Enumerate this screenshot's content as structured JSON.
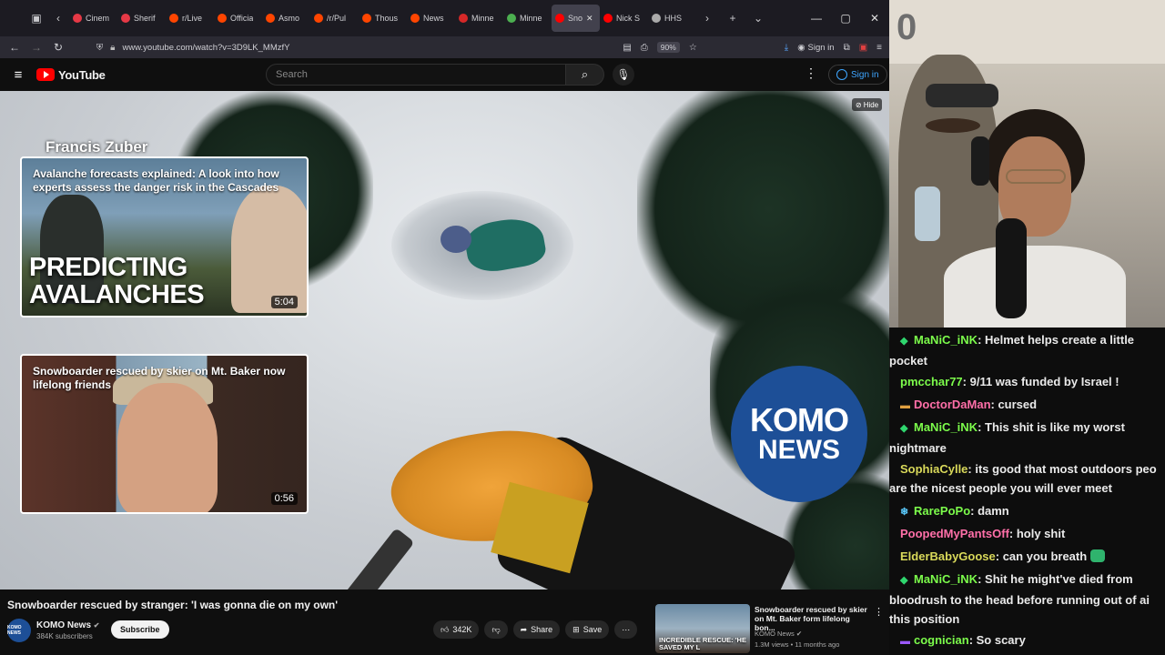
{
  "browser": {
    "tabs": [
      {
        "label": "Cinem",
        "active": false,
        "color": "#e63946"
      },
      {
        "label": "Sherif",
        "active": false,
        "color": "#e63946"
      },
      {
        "label": "r/Live",
        "active": false,
        "color": "#ff4500"
      },
      {
        "label": "Officia",
        "active": false,
        "color": "#ff4500"
      },
      {
        "label": "Asmo",
        "active": false,
        "color": "#ff4500"
      },
      {
        "label": "/r/Pul",
        "active": false,
        "color": "#ff4500"
      },
      {
        "label": "Thous",
        "active": false,
        "color": "#ff4500"
      },
      {
        "label": "News",
        "active": false,
        "color": "#ff4500"
      },
      {
        "label": "Minne",
        "active": false,
        "color": "#d62828"
      },
      {
        "label": "Minne",
        "active": false,
        "color": "#4caf50"
      },
      {
        "label": "Sno",
        "active": true,
        "color": "#ff0000"
      },
      {
        "label": "Nick S",
        "active": false,
        "color": "#ff0000"
      },
      {
        "label": "HHS",
        "active": false,
        "color": "#aaaaaa"
      }
    ],
    "url": "www.youtube.com/watch?v=3D9LK_MMzfY",
    "zoom": "90%",
    "signin_label": "Sign in"
  },
  "youtube": {
    "logo_text": "YouTube",
    "search_placeholder": "Search",
    "signin_label": "Sign in",
    "hide_label": "Hide"
  },
  "video": {
    "author_overlay": "Francis Zuber",
    "endcards": [
      {
        "title": "Avalanche forecasts explained: A look into how experts assess the danger risk in the Cascades",
        "big_text": "PREDICTING AVALANCHES",
        "duration": "5:04"
      },
      {
        "title": "Snowboarder rescued by skier on Mt. Baker now lifelong friends",
        "duration": "0:56"
      }
    ],
    "komo_line1": "KOMO",
    "komo_line2": "NEWS",
    "title": "Snowboarder rescued by stranger: 'I was gonna die on my own'",
    "channel": "KOMO News",
    "channel_avatar_text": "KOMO NEWS",
    "subscribers": "384K subscribers",
    "subscribe_label": "Subscribe",
    "likes": "342K",
    "share_label": "Share",
    "save_label": "Save",
    "related": {
      "title": "Snowboarder rescued by skier on Mt. Baker form lifelong bon...",
      "channel": "KOMO News",
      "meta": "1.3M views • 11 months ago",
      "thumb_text": "INCREDIBLE RESCUE: 'HE SAVED MY L"
    }
  },
  "stream": {
    "cam_overlay": "0",
    "chat": [
      {
        "badge": "◆",
        "badge_color": "#2fd66e",
        "user": "MaNiC_iNK",
        "color": "#7cfc4b",
        "text": ": Helmet helps create a little",
        "cont": "pocket"
      },
      {
        "badge": "",
        "badge_color": "",
        "user": "pmcchar77",
        "color": "#7cfc4b",
        "text": ": 9/11 was funded by Israel !",
        "cont": ""
      },
      {
        "badge": "▬",
        "badge_color": "#e0a040",
        "user": "DoctorDaMan",
        "color": "#ff6fa8",
        "text": ": cursed",
        "cont": ""
      },
      {
        "badge": "◆",
        "badge_color": "#2fd66e",
        "user": "MaNiC_iNK",
        "color": "#7cfc4b",
        "text": ": This shit is like my worst",
        "cont": "nightmare"
      },
      {
        "badge": "",
        "badge_color": "",
        "user": "SophiaCylle",
        "color": "#d9d95a",
        "text": ": its good that most outdoors peo",
        "cont": "are the nicest people you will ever meet"
      },
      {
        "badge": "❄",
        "badge_color": "#5ac8fa",
        "user": "RarePoPo",
        "color": "#7cfc4b",
        "text": ": damn",
        "cont": ""
      },
      {
        "badge": "",
        "badge_color": "",
        "user": "PoopedMyPantsOff",
        "color": "#ff6fa8",
        "text": ": holy shit",
        "cont": ""
      },
      {
        "badge": "",
        "badge_color": "",
        "user": "ElderBabyGoose",
        "color": "#d9d95a",
        "text": ": can you breath",
        "cont": "",
        "emote": true
      },
      {
        "badge": "◆",
        "badge_color": "#2fd66e",
        "user": "MaNiC_iNK",
        "color": "#7cfc4b",
        "text": ": Shit he might've died from",
        "cont": "bloodrush to the head before running out of ai",
        "cont2": "this position"
      },
      {
        "badge": "▬",
        "badge_color": "#9b59ff",
        "user": "cognician",
        "color": "#7cfc4b",
        "text": ": So scary",
        "cont": ""
      }
    ]
  }
}
